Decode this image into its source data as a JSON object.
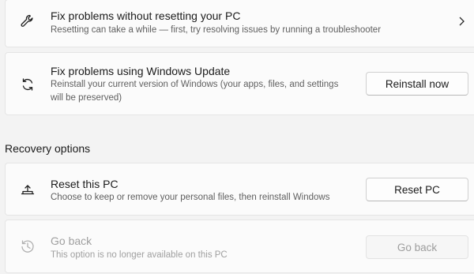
{
  "fix_without_reset": {
    "title": "Fix problems without resetting your PC",
    "description": "Resetting can take a while — first, try resolving issues by running a troubleshooter",
    "icon": "wrench-icon"
  },
  "fix_windows_update": {
    "title": "Fix problems using Windows Update",
    "description": "Reinstall your current version of Windows (your apps, files, and settings will be preserved)",
    "button_label": "Reinstall now",
    "icon": "refresh-icon"
  },
  "recovery_options": {
    "header": "Recovery options",
    "reset_pc": {
      "title": "Reset this PC",
      "description": "Choose to keep or remove your personal files, then reinstall Windows",
      "button_label": "Reset PC",
      "icon": "reset-pc-icon"
    },
    "go_back": {
      "title": "Go back",
      "description": "This option is no longer available on this PC",
      "button_label": "Go back",
      "icon": "history-icon",
      "enabled": false
    }
  }
}
